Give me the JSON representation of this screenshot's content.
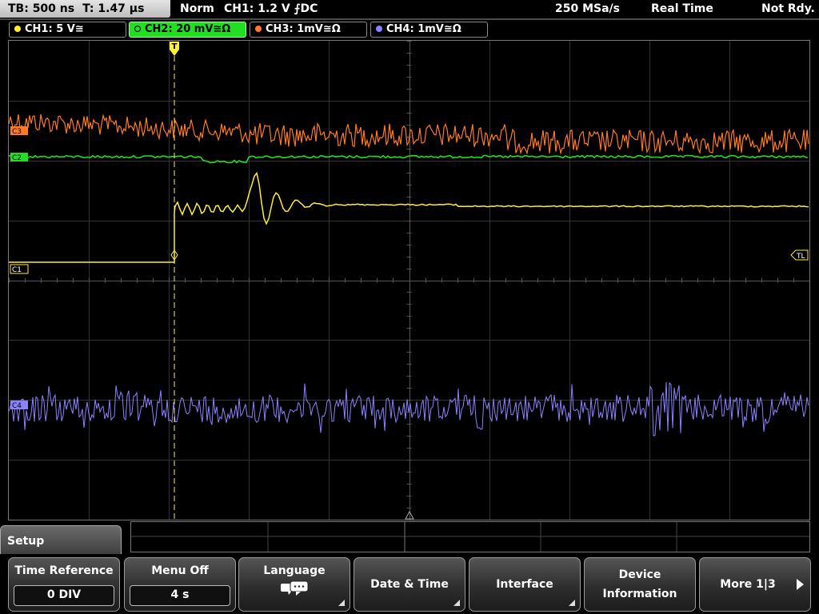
{
  "status_bar": {
    "timebase": "TB: 500 ns",
    "trigger_time": "T: 1.47 µs",
    "trigger_mode": "Norm",
    "trigger_info": "CH1: 1.2 V ⨍DC",
    "sample_rate": "250 MSa/s",
    "acq_mode": "Real Time",
    "ready_state": "Not Rdy."
  },
  "channels": [
    {
      "label": "CH1: 5 V≅",
      "color": "#ffee33"
    },
    {
      "label": "CH2: 20 mV≅Ω",
      "color": "#22dd22",
      "active": true
    },
    {
      "label": "CH3: 1mV≅Ω",
      "color": "#ff7a22"
    },
    {
      "label": "CH4: 1mV≅Ω",
      "color": "#8a82ff"
    }
  ],
  "markers": {
    "trigger": "T",
    "trigger_level": "TL",
    "ch1_ref": "C1",
    "ch2_ref": "C2",
    "ch3_ref": "C3",
    "ch4_ref": "C4"
  },
  "menu": {
    "title": "Setup",
    "keys": [
      {
        "label": "Time Reference",
        "value": "0 DIV"
      },
      {
        "label": "Menu Off",
        "value": "4 s"
      },
      {
        "label": "Language",
        "icon": "speech-bubbles-icon"
      },
      {
        "label": "Date & Time"
      },
      {
        "label": "Interface"
      },
      {
        "label_line1": "Device",
        "label_line2": "Information"
      },
      {
        "label": "More 1|3"
      }
    ]
  }
}
